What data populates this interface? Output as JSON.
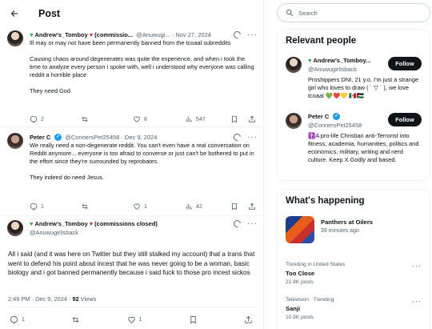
{
  "header": {
    "title": "Post"
  },
  "tweets": [
    {
      "name": "Andrew's_Tomboy",
      "name_suffix": "(commissio...",
      "handle": "@Anuwugi...",
      "date": "· Nov 27, 2024",
      "paragraphs": [
        "Ill may or may not have been permanently banned from the tcoaal subreddits",
        "Causing chaos around degenerates was quite the experience, and when i took the time to analyze every person i spoke with, well i understood why everyone was calling reddit a horrible place",
        "They need God"
      ],
      "stats": {
        "replies": "2",
        "reposts": "",
        "likes": "8",
        "views": "547"
      }
    },
    {
      "name": "Peter C",
      "handle": "@ConnersPet25458",
      "date": "· Dec 9, 2024",
      "paragraphs": [
        "We really need a non-degenerate reddit. You can't even have a real conversation on Reddit anymore... everyone is too afraid to converse or just can't be bothered to put in the effort since they're surrounded by reprobates.",
        "They indeed do need Jesus."
      ],
      "stats": {
        "replies": "1",
        "reposts": "",
        "likes": "1",
        "views": "42"
      }
    }
  ],
  "focused": {
    "name": "Andrew's_Tomboy",
    "name_suffix": "(commissions closed)",
    "handle": "@Anuwugirlisback",
    "text": "All i said (and it was here on Twitter but they still stalked my account) that a trans that went to defend his point about incest that he was never going to be a woman, basic biology and i got banned permanently because i said fuck to those pro incest sickos",
    "time": "2:49 PM · Dec 9, 2024 · ",
    "views": "92",
    "views_label": " Views",
    "stats": {
      "replies": "1",
      "likes": "1"
    }
  },
  "sidebar": {
    "search_placeholder": "Search",
    "relevant_title": "Relevant people",
    "people": [
      {
        "name": "Andrew's_Tomboy...",
        "handle": "@Anuwugirlisback",
        "bio": "Proshippers DNI, 21 y.o, I'm just a strange girl who loves to draw ( ´ ▽ ` ), we love tcoaal 💚❤️💛 🇲🇽🇵🇸",
        "button": "Follow"
      },
      {
        "name": "Peter C",
        "handle": "@ConnersPet25458",
        "bio": "✝️A pro-life Christian anti-Terrorist into fitness, academia, humanities, politics and economics, military, writing and nerd culture. Keep X Godly and based.",
        "button": "Follow"
      }
    ],
    "happening_title": "What's happening",
    "happening": {
      "title": "Panthers at Oilers",
      "time": "39 minutes ago"
    },
    "trends": [
      {
        "context": "Trending in United States",
        "name": "Too Close",
        "count": "21.9K posts"
      },
      {
        "context": "Television · Trending",
        "name": "Sanji",
        "count": "10.9K posts"
      }
    ]
  }
}
